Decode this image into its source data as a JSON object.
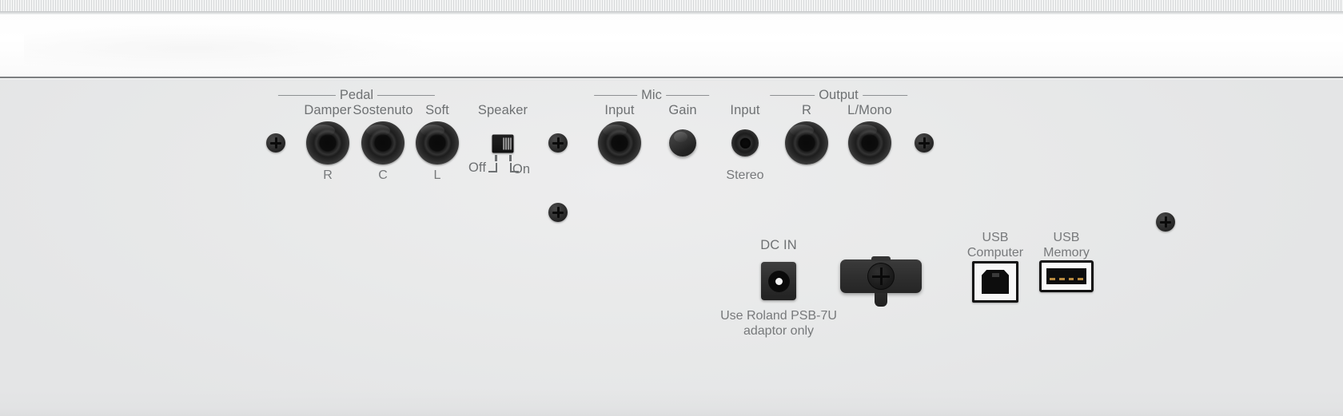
{
  "device": {
    "surface": "rear connector panel",
    "panel_color": "#e9eaea",
    "label_color": "#6e7173",
    "brand_note": "Use Roland PSB-7U adaptor only"
  },
  "groups": {
    "pedal": "Pedal",
    "mic": "Mic",
    "output": "Output"
  },
  "pedal": {
    "jacks": [
      {
        "label": "Damper",
        "sub": "R"
      },
      {
        "label": "Sostenuto",
        "sub": "C"
      },
      {
        "label": "Soft",
        "sub": "L"
      }
    ]
  },
  "speaker": {
    "label": "Speaker",
    "off": "Off",
    "on": "On",
    "position": "Off"
  },
  "mic": {
    "input_label": "Input",
    "gain_label": "Gain"
  },
  "line_in": {
    "label": "Input",
    "sub": "Stereo"
  },
  "output": {
    "jacks": [
      {
        "label": "R"
      },
      {
        "label": "L/Mono"
      }
    ]
  },
  "power": {
    "dc_label": "DC IN",
    "note_line1": "Use Roland PSB-7U",
    "note_line2": "adaptor only"
  },
  "usb": {
    "computer_line1": "USB",
    "computer_line2": "Computer",
    "memory_line1": "USB",
    "memory_line2": "Memory"
  }
}
